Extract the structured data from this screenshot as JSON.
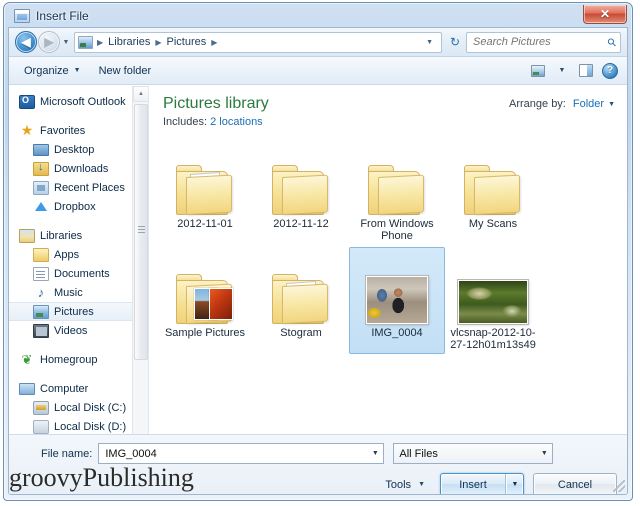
{
  "window": {
    "title": "Insert File",
    "close_label": "✕",
    "icon": "picture-window-icon"
  },
  "nav": {
    "back_label": "◀",
    "forward_label": "▶",
    "recent_dropdown": "▼",
    "breadcrumbs": [
      "Libraries",
      "Pictures"
    ],
    "separator": "▶",
    "address_dropdown": "▼",
    "refresh_label": "↻",
    "search_placeholder": "Search Pictures",
    "search_value": "",
    "search_icon": "⚲"
  },
  "toolbar": {
    "organize_label": "Organize",
    "organize_caret": "▼",
    "new_folder_label": "New folder",
    "view_caret": "▼",
    "help_label": "?"
  },
  "sidebar": {
    "items": [
      {
        "label": "Microsoft Outlook",
        "icon": "outlook-icon",
        "icon_class": "ni-outlook",
        "indent": false,
        "selected": false,
        "spacer_before": false
      },
      {
        "label": "Favorites",
        "icon": "star-icon",
        "icon_class": "ni-star",
        "glyph": "★",
        "indent": false,
        "selected": false,
        "spacer_before": true
      },
      {
        "label": "Desktop",
        "icon": "desktop-icon",
        "icon_class": "ni-desktop",
        "indent": true,
        "selected": false,
        "spacer_before": false
      },
      {
        "label": "Downloads",
        "icon": "downloads-icon",
        "icon_class": "ni-download",
        "indent": true,
        "selected": false,
        "spacer_before": false
      },
      {
        "label": "Recent Places",
        "icon": "recent-places-icon",
        "icon_class": "ni-recent",
        "indent": true,
        "selected": false,
        "spacer_before": false
      },
      {
        "label": "Dropbox",
        "icon": "dropbox-icon",
        "icon_class": "ni-dropbox",
        "indent": true,
        "selected": false,
        "spacer_before": false
      },
      {
        "label": "Libraries",
        "icon": "libraries-icon",
        "icon_class": "ni-libraries",
        "indent": false,
        "selected": false,
        "spacer_before": true
      },
      {
        "label": "Apps",
        "icon": "folder-icon",
        "icon_class": "ni-folder",
        "indent": true,
        "selected": false,
        "spacer_before": false
      },
      {
        "label": "Documents",
        "icon": "documents-icon",
        "icon_class": "ni-doc",
        "indent": true,
        "selected": false,
        "spacer_before": false
      },
      {
        "label": "Music",
        "icon": "music-icon",
        "icon_class": "ni-music",
        "glyph": "♪",
        "indent": true,
        "selected": false,
        "spacer_before": false
      },
      {
        "label": "Pictures",
        "icon": "pictures-icon",
        "icon_class": "ni-pictures",
        "indent": true,
        "selected": true,
        "spacer_before": false
      },
      {
        "label": "Videos",
        "icon": "videos-icon",
        "icon_class": "ni-video",
        "indent": true,
        "selected": false,
        "spacer_before": false
      },
      {
        "label": "Homegroup",
        "icon": "homegroup-icon",
        "icon_class": "ni-homegroup",
        "glyph": "❦",
        "indent": false,
        "selected": false,
        "spacer_before": true
      },
      {
        "label": "Computer",
        "icon": "computer-icon",
        "icon_class": "ni-computer",
        "indent": false,
        "selected": false,
        "spacer_before": true
      },
      {
        "label": "Local Disk (C:)",
        "icon": "local-disk-icon",
        "icon_class": "ni-disk",
        "indent": true,
        "selected": false,
        "spacer_before": false
      },
      {
        "label": "Local Disk (D:)",
        "icon": "local-disk-icon",
        "icon_class": "ni-disk-plain",
        "indent": true,
        "selected": false,
        "spacer_before": false
      }
    ],
    "scroll_up": "▲",
    "scroll_down": "▼"
  },
  "library": {
    "title": "Pictures library",
    "includes_label": "Includes:",
    "includes_link": "2 locations",
    "arrange_label": "Arrange by:",
    "arrange_value": "Folder",
    "arrange_caret": "▼"
  },
  "items": [
    {
      "name": "2012-11-01",
      "kind": "folder-doc",
      "selected": false
    },
    {
      "name": "2012-11-12",
      "kind": "folder-plain",
      "selected": false
    },
    {
      "name": "From Windows Phone",
      "kind": "folder-tabs",
      "selected": false
    },
    {
      "name": "My Scans",
      "kind": "folder-tabs",
      "selected": false
    },
    {
      "name": "Sample Pictures",
      "kind": "folder-pics",
      "selected": false
    },
    {
      "name": "Stogram",
      "kind": "folder-doc",
      "selected": false
    },
    {
      "name": "IMG_0004",
      "kind": "photo-img0004",
      "selected": true
    },
    {
      "name": "vlcsnap-2012-10-27-12h01m13s49",
      "kind": "photo-vlcsnap",
      "selected": false
    }
  ],
  "bottom": {
    "filename_label": "File name:",
    "filename_value": "IMG_0004",
    "filename_caret": "▼",
    "filetype_value": "All Files",
    "filetype_caret": "▼",
    "tools_label": "Tools",
    "tools_caret": "▼",
    "insert_label": "Insert",
    "insert_caret": "▼",
    "cancel_label": "Cancel"
  },
  "watermark": {
    "text": "groovyPublishing"
  },
  "colors": {
    "accent_blue": "#1a6fb5",
    "library_green": "#2a7a3f",
    "selection_blue": "#c2dff5",
    "close_red": "#c94a33"
  }
}
